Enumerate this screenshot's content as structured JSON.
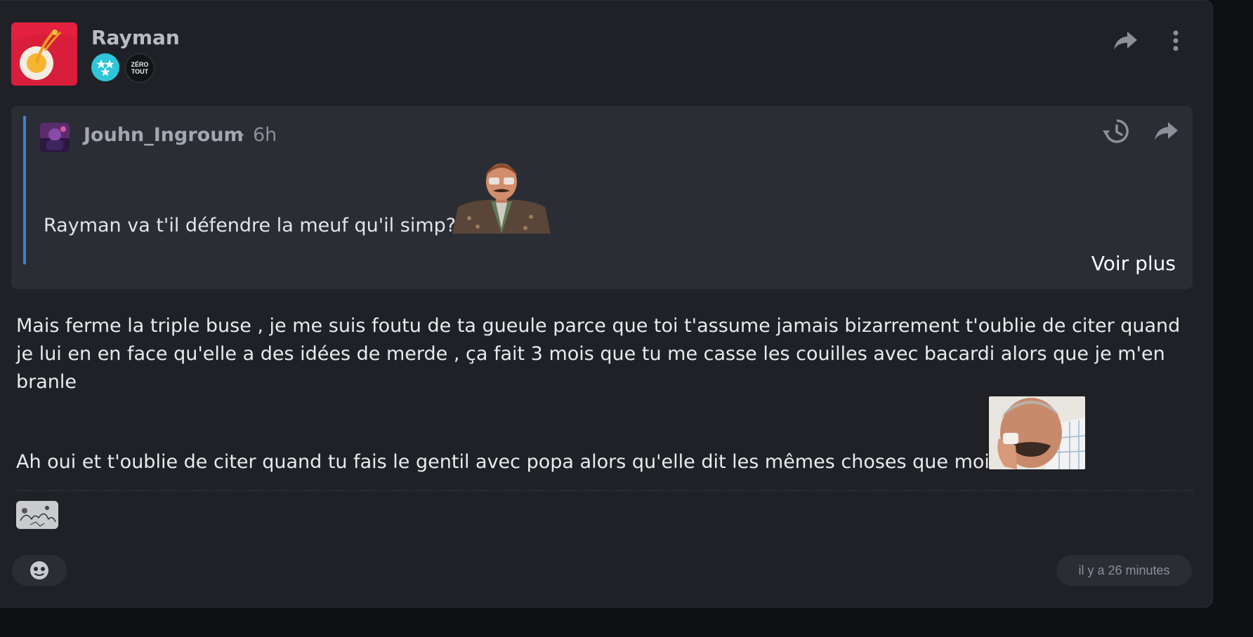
{
  "post": {
    "author": "Rayman",
    "badges": [
      {
        "name": "stars-badge",
        "color": "#2ec5d8"
      },
      {
        "name": "zero-tout-badge",
        "line1": "ZÉRO",
        "line2": "TOUT"
      }
    ],
    "quote": {
      "author": "Jouhn_Ingroum",
      "separator": "·",
      "time": "6h",
      "text": "Rayman va t'il défendre la meuf qu'il simp?",
      "more_label": "Voir plus",
      "accent_color": "#3b82d6"
    },
    "paragraphs": [
      "Mais ferme la triple buse , je me suis foutu de ta gueule parce que toi t'assume jamais bizarrement t'oublie de citer quand je lui en en face qu'elle a des idées de merde , ça fait 3 mois que tu me casse les couilles avec bacardi alors que je m'en branle",
      "Ah oui et t'oublie de citer quand tu fais le gentil avec popa alors qu'elle dit les mêmes choses que moi"
    ],
    "timestamp": "il y a 26 minutes"
  },
  "icons": {
    "share": "share-arrow-icon",
    "more": "more-vertical-icon",
    "history": "history-icon",
    "react": "emoji-react-icon"
  }
}
